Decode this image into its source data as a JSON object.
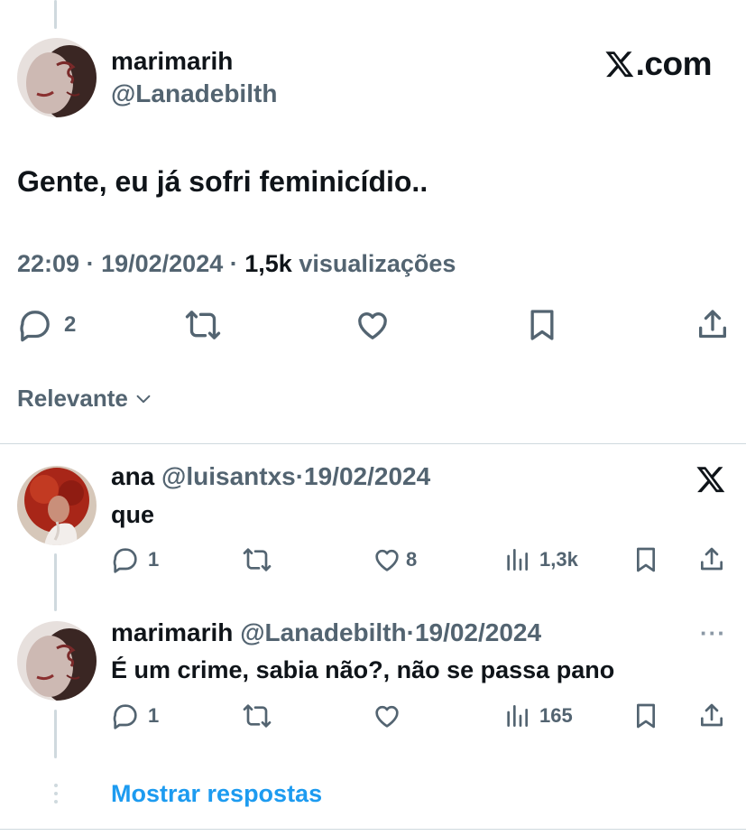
{
  "main_tweet": {
    "author_name": "marimarih",
    "author_handle": "@Lanadebilth",
    "site": ".com",
    "text": "Gente, eu já sofri feminicídio..",
    "time": "22:09",
    "sep1": "·",
    "date": "19/02/2024",
    "sep2": "·",
    "views": "1,5k",
    "views_label": "visualizações",
    "reply_count": "2",
    "icons": [
      "reply-icon",
      "retweet-icon",
      "like-icon",
      "bookmark-icon",
      "share-icon",
      "x-logo-icon"
    ]
  },
  "sort": {
    "label": "Relevante"
  },
  "replies": [
    {
      "author_name": "ana",
      "author_handle": "@luisantxs",
      "sep": "·",
      "date": "19/02/2024",
      "text": "que",
      "reply_count": "1",
      "likes": "8",
      "views": "1,3k"
    },
    {
      "author_name": "marimarih",
      "author_handle": "@Lanadebilth",
      "sep": "·",
      "date": "19/02/2024",
      "text": "É um crime, sabia não?, não se passa pano",
      "reply_count": "1",
      "likes": "",
      "views": "165"
    }
  ],
  "more_label": "···",
  "show_replies": "Mostrar respostas",
  "colors": {
    "text": "#0f1419",
    "secondary": "#536471",
    "link": "#1d9bf0",
    "divider": "#cfd9de"
  }
}
